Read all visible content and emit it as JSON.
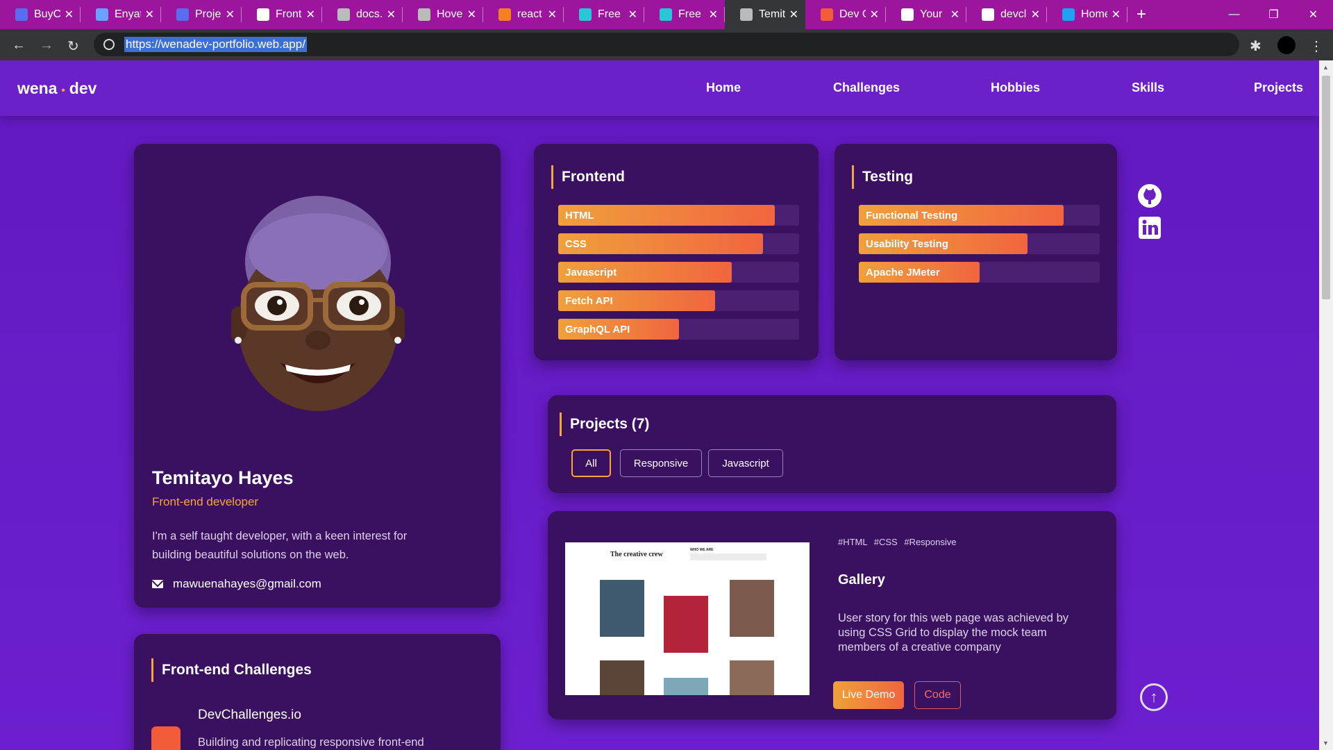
{
  "browser": {
    "tabs": [
      {
        "title": "BuyCo",
        "favicon": "list-icon",
        "color": "#5a6cf0"
      },
      {
        "title": "Enyata",
        "favicon": "stack-icon",
        "color": "#6aa0ff"
      },
      {
        "title": "Projec",
        "favicon": "list-icon",
        "color": "#5a6cf0"
      },
      {
        "title": "Front",
        "favicon": "doc-icon",
        "color": "#ffffff"
      },
      {
        "title": "docs.",
        "favicon": "globe-icon",
        "color": "#bbbbbb"
      },
      {
        "title": "Hove",
        "favicon": "globe-icon",
        "color": "#bbbbbb"
      },
      {
        "title": "react",
        "favicon": "stackoverflow-icon",
        "color": "#f48024"
      },
      {
        "title": "Free I",
        "favicon": "spin-icon",
        "color": "#27c7d8"
      },
      {
        "title": "Free C",
        "favicon": "spin-icon",
        "color": "#27c7d8"
      },
      {
        "title": "Temit",
        "favicon": "globe-icon",
        "color": "#bbbbbb",
        "active": true
      },
      {
        "title": "Dev C",
        "favicon": "devchallenges-icon",
        "color": "#f35b3a"
      },
      {
        "title": "Your",
        "favicon": "github-icon",
        "color": "#ffffff"
      },
      {
        "title": "devcl",
        "favicon": "github-icon",
        "color": "#ffffff"
      },
      {
        "title": "Home",
        "favicon": "twitter-icon",
        "color": "#1da1f2"
      }
    ],
    "url": "https://wenadev-portfolio.web.app/"
  },
  "site": {
    "logo_left": "wena",
    "logo_dot": "•",
    "logo_right": "dev",
    "nav": [
      "Home",
      "Challenges",
      "Hobbies",
      "Skills",
      "Projects"
    ]
  },
  "profile": {
    "name": "Temitayo Hayes",
    "role": "Front-end developer",
    "bio": "I'm a self taught developer, with a keen interest for building beautiful solutions on the web.",
    "email": "mawuenahayes@gmail.com"
  },
  "challenges": {
    "title": "Front-end Challenges",
    "item_title": "DevChallenges.io",
    "item_desc": "Building and replicating responsive front-end"
  },
  "skills": {
    "frontend": {
      "title": "Frontend",
      "items": [
        {
          "label": "HTML",
          "level": 0.9
        },
        {
          "label": "CSS",
          "level": 0.85
        },
        {
          "label": "Javascript",
          "level": 0.72
        },
        {
          "label": "Fetch API",
          "level": 0.65
        },
        {
          "label": "GraphQL API",
          "level": 0.5
        }
      ]
    },
    "testing": {
      "title": "Testing",
      "items": [
        {
          "label": "Functional Testing",
          "level": 0.85
        },
        {
          "label": "Usability Testing",
          "level": 0.7
        },
        {
          "label": "Apache JMeter",
          "level": 0.5
        }
      ]
    }
  },
  "projects": {
    "title": "Projects (7)",
    "filters": [
      "All",
      "Responsive",
      "Javascript"
    ],
    "active_filter": "All",
    "featured": {
      "tags": "#HTML #CSS #Responsive",
      "title": "Gallery",
      "description": "User story for this web page was achieved by using CSS Grid to display the mock team members of a creative company",
      "demo_label": "Live Demo",
      "code_label": "Code",
      "thumb_heading": "The creative crew",
      "thumb_subheading": "WHO WE ARE"
    }
  },
  "colors": {
    "accent": "#f6a63b",
    "card": "#3a1060",
    "background": "#6b1fc4"
  }
}
